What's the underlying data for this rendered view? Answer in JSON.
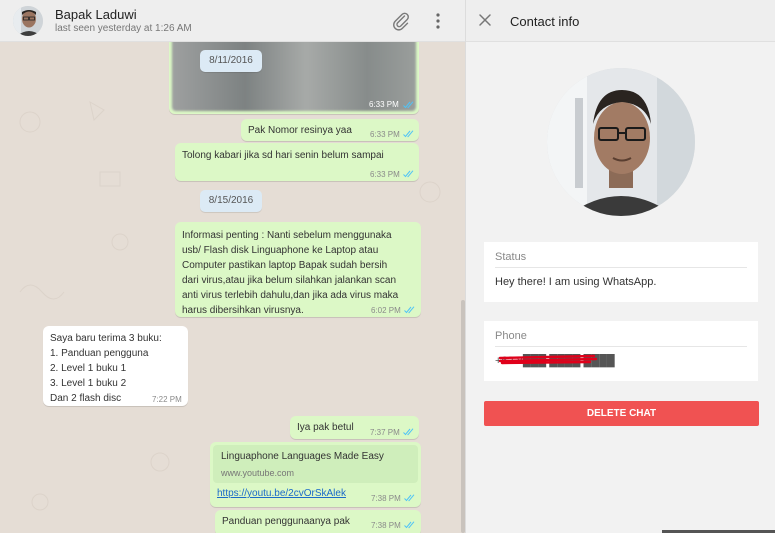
{
  "chat": {
    "contact_name": "Bapak Laduwi",
    "last_seen": "last seen yesterday at 1:26 AM",
    "messages": [
      {
        "kind": "image",
        "time": "6:33 PM"
      },
      {
        "kind": "date",
        "text": "8/11/2016"
      },
      {
        "kind": "out",
        "text": "Pak Nomor resinya yaa",
        "time": "6:33 PM"
      },
      {
        "kind": "out",
        "text": "Tolong kabari jika sd hari senin belum sampai",
        "time": "6:33 PM"
      },
      {
        "kind": "date",
        "text": "8/15/2016"
      },
      {
        "kind": "out",
        "text": "Informasi penting : Nanti sebelum menggunaka\nusb/ Flash disk Linguaphone ke Laptop atau\nComputer pastikan laptop Bapak sudah bersih\ndari virus,atau jika belum silahkan jalankan scan\nanti virus terlebih dahulu,dan jika ada virus maka\nharus dibersihkan virusnya.",
        "time": "6:02 PM"
      },
      {
        "kind": "in",
        "text": "Saya baru terima 3 buku:\n1. Panduan pengguna\n2. Level 1 buku 1\n3. Level 1 buku 2\nDan 2 flash disc",
        "time": "7:22 PM"
      },
      {
        "kind": "out",
        "text": "Iya pak betul",
        "time": "7:37 PM"
      },
      {
        "kind": "link",
        "preview_title": "Linguaphone Languages Made Easy",
        "preview_domain": "www.youtube.com",
        "url": "https://youtu.be/2cvOrSkAlek",
        "time": "7:38 PM"
      },
      {
        "kind": "out",
        "text": "Panduan penggunaanya pak",
        "time": "7:38 PM"
      }
    ]
  },
  "info": {
    "title": "Contact info",
    "status_label": "Status",
    "status_value": "Hey there! I am using WhatsApp.",
    "phone_label": "Phone",
    "phone_value": "+62 8███ ████ ████",
    "delete_label": "DELETE CHAT"
  },
  "colors": {
    "out_bubble": "#dcf8c6",
    "in_bubble": "#ffffff",
    "chat_bg": "#e5ddd5",
    "tick_blue": "#4fc3f7",
    "delete": "#f05252",
    "redaction": "#e0001a"
  },
  "icons": {
    "attach": "paperclip-icon",
    "menu": "more-vertical-icon",
    "close": "close-icon",
    "read": "double-check-icon"
  }
}
